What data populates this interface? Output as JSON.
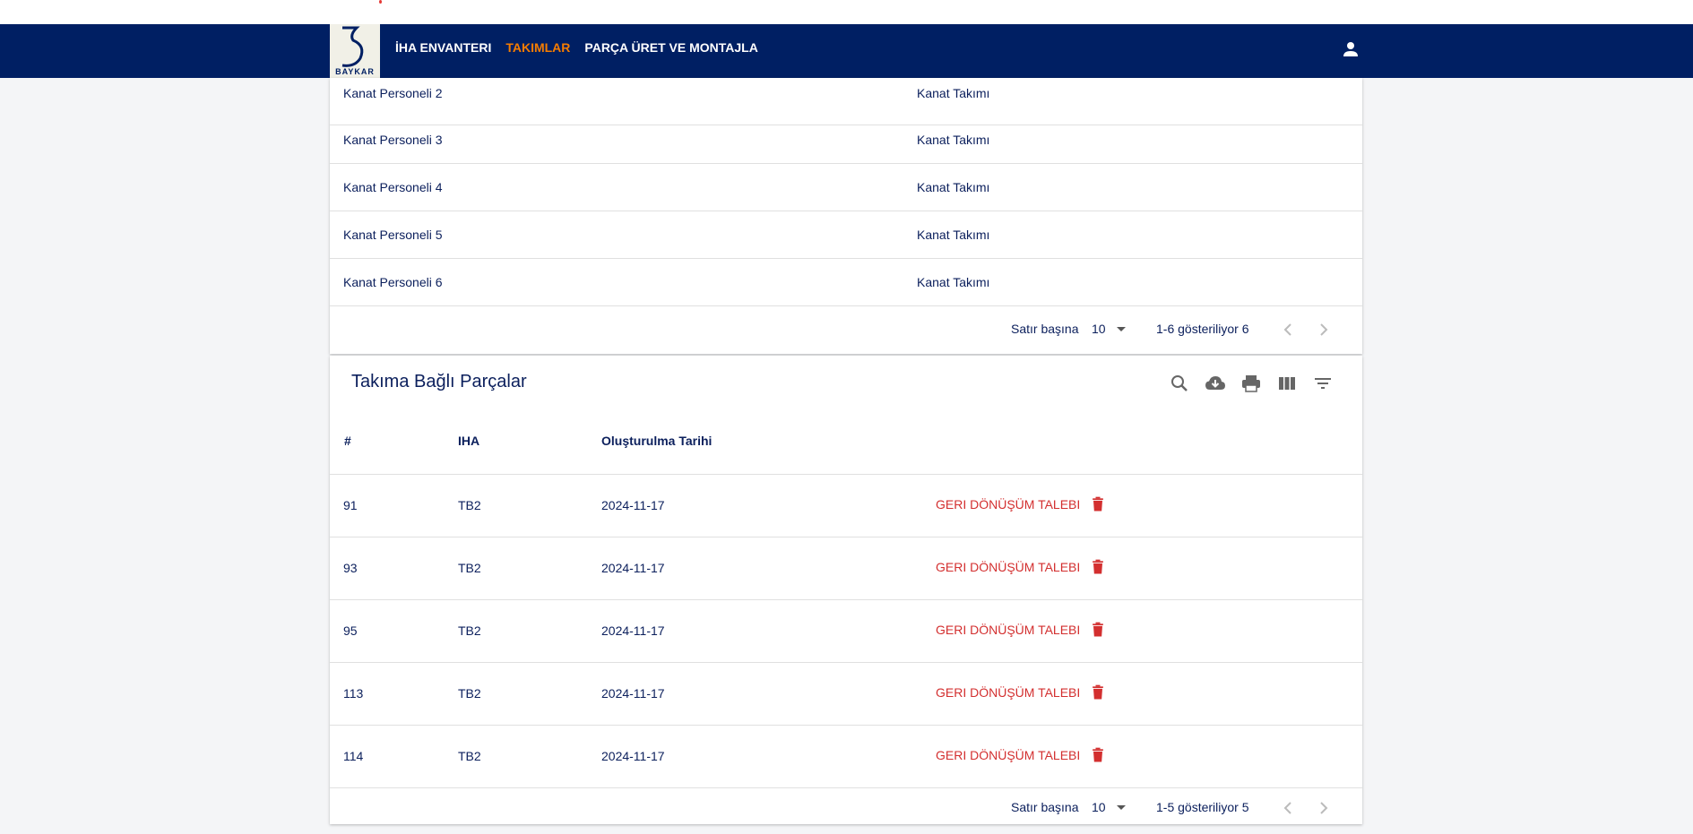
{
  "nav": {
    "logo_text": "BAYKAR",
    "links": [
      "İHA ENVANTERI",
      "TAKIMLAR",
      "PARÇA ÜRET VE MONTAJLA"
    ],
    "active_link": "TAKIMLAR",
    "accent_color": "#f57c00",
    "bar_color": "#001f63"
  },
  "members_table": {
    "rows": [
      {
        "name": "Kanat Personeli 2",
        "team": "Kanat Takımı"
      },
      {
        "name": "Kanat Personeli 3",
        "team": "Kanat Takımı"
      },
      {
        "name": "Kanat Personeli 4",
        "team": "Kanat Takımı"
      },
      {
        "name": "Kanat Personeli 5",
        "team": "Kanat Takımı"
      },
      {
        "name": "Kanat Personeli 6",
        "team": "Kanat Takımı"
      }
    ],
    "pager": {
      "rows_per_page_label": "Satır başına",
      "rows_per_page": "10",
      "range": "1-6 gösteriliyor 6"
    }
  },
  "parts_table": {
    "title": "Takıma Bağlı Parçalar",
    "toolbar_icons": [
      "search-icon",
      "cloud-download-icon",
      "print-icon",
      "view-columns-icon",
      "filter-icon"
    ],
    "columns": [
      "#",
      "IHA",
      "Oluşturulma Tarihi"
    ],
    "action_label": "GERI DÖNÜŞÜM TALEBI",
    "action_color": "#d32f2f",
    "rows": [
      {
        "id": "91",
        "iha": "TB2",
        "date": "2024-11-17"
      },
      {
        "id": "93",
        "iha": "TB2",
        "date": "2024-11-17"
      },
      {
        "id": "95",
        "iha": "TB2",
        "date": "2024-11-17"
      },
      {
        "id": "113",
        "iha": "TB2",
        "date": "2024-11-17"
      },
      {
        "id": "114",
        "iha": "TB2",
        "date": "2024-11-17"
      }
    ],
    "pager": {
      "rows_per_page_label": "Satır başına",
      "rows_per_page": "10",
      "range": "1-5 gösteriliyor 5"
    }
  }
}
